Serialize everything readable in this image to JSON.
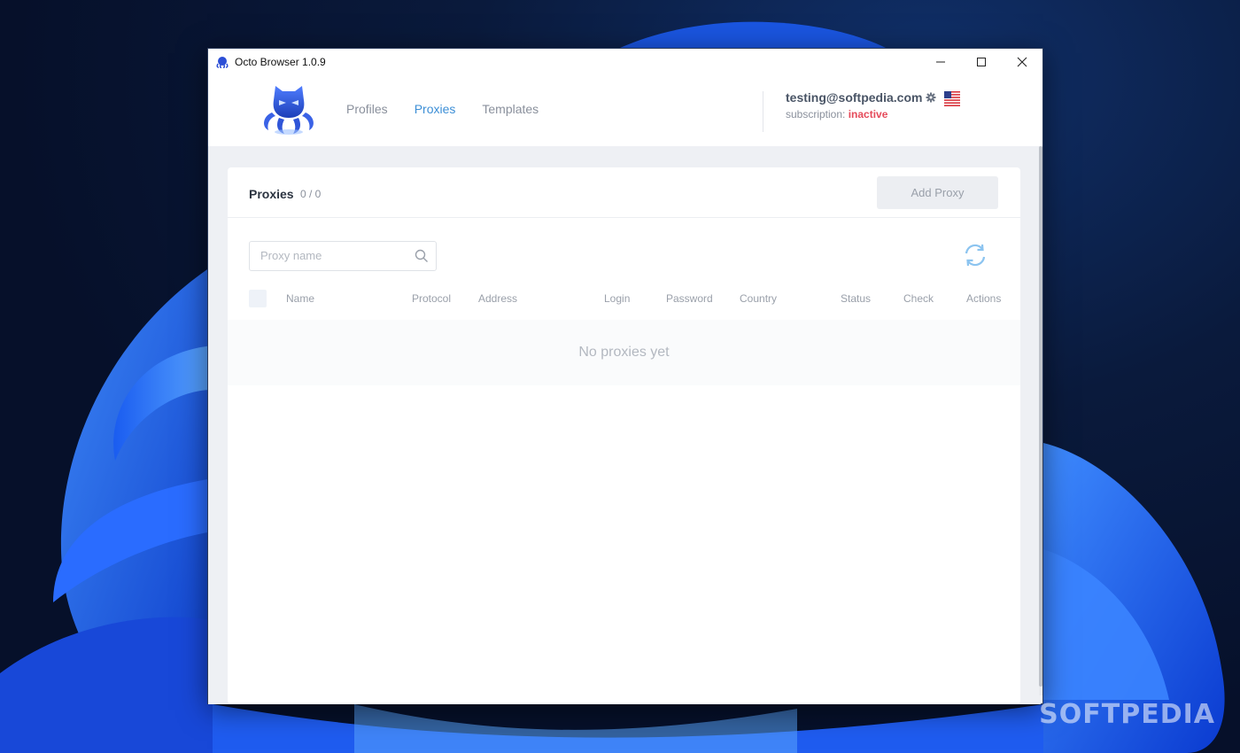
{
  "window": {
    "title": "Octo Browser 1.0.9"
  },
  "nav": {
    "items": [
      {
        "label": "Profiles",
        "active": false
      },
      {
        "label": "Proxies",
        "active": true
      },
      {
        "label": "Templates",
        "active": false
      }
    ]
  },
  "account": {
    "email": "testing@softpedia.com",
    "subscription_label": "subscription:",
    "subscription_status": "inactive",
    "flag": "us-flag-icon"
  },
  "proxies": {
    "title": "Proxies",
    "count": "0 / 0",
    "add_button": "Add Proxy",
    "search_placeholder": "Proxy name",
    "columns": [
      "Name",
      "Protocol",
      "Address",
      "Login",
      "Password",
      "Country",
      "Status",
      "Check",
      "Actions"
    ],
    "empty_message": "No proxies yet"
  },
  "watermark": "SOFTPEDIA",
  "colors": {
    "accent": "#3d8fd6",
    "inactive": "#e54a5a",
    "muted_text": "#8a909c"
  }
}
